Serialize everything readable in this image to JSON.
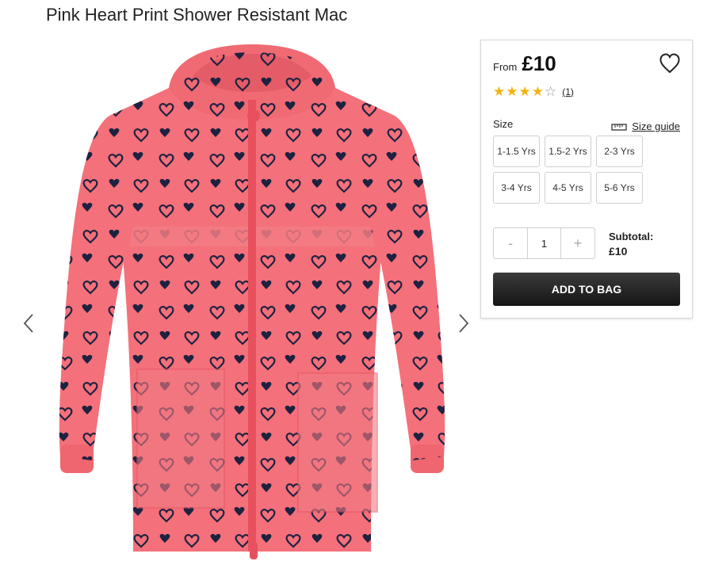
{
  "product": {
    "title": "Pink Heart Print Shower Resistant Mac"
  },
  "gallery": {
    "prev_icon": "chevron-left-icon",
    "next_icon": "chevron-right-icon"
  },
  "purchase": {
    "from_label": "From",
    "price": "£10",
    "wishlist_icon": "heart-outline-icon",
    "rating": {
      "stars": 4,
      "max": 5,
      "count_label": "(1)"
    },
    "size_label": "Size",
    "size_guide_label": "Size guide",
    "size_guide_icon": "ruler-icon",
    "sizes": [
      "1-1.5 Yrs",
      "1.5-2 Yrs",
      "2-3 Yrs",
      "3-4 Yrs",
      "4-5 Yrs",
      "5-6 Yrs"
    ],
    "quantity": {
      "minus": "-",
      "value": "1",
      "plus": "+"
    },
    "subtotal_label": "Subtotal:",
    "subtotal_value": "£10",
    "add_to_bag": "ADD TO BAG"
  },
  "colors": {
    "jacket_pink": "#f4707a",
    "heart_navy": "#1e2240",
    "star_gold": "#f2b40f",
    "button_dark": "#1f1f1f"
  }
}
